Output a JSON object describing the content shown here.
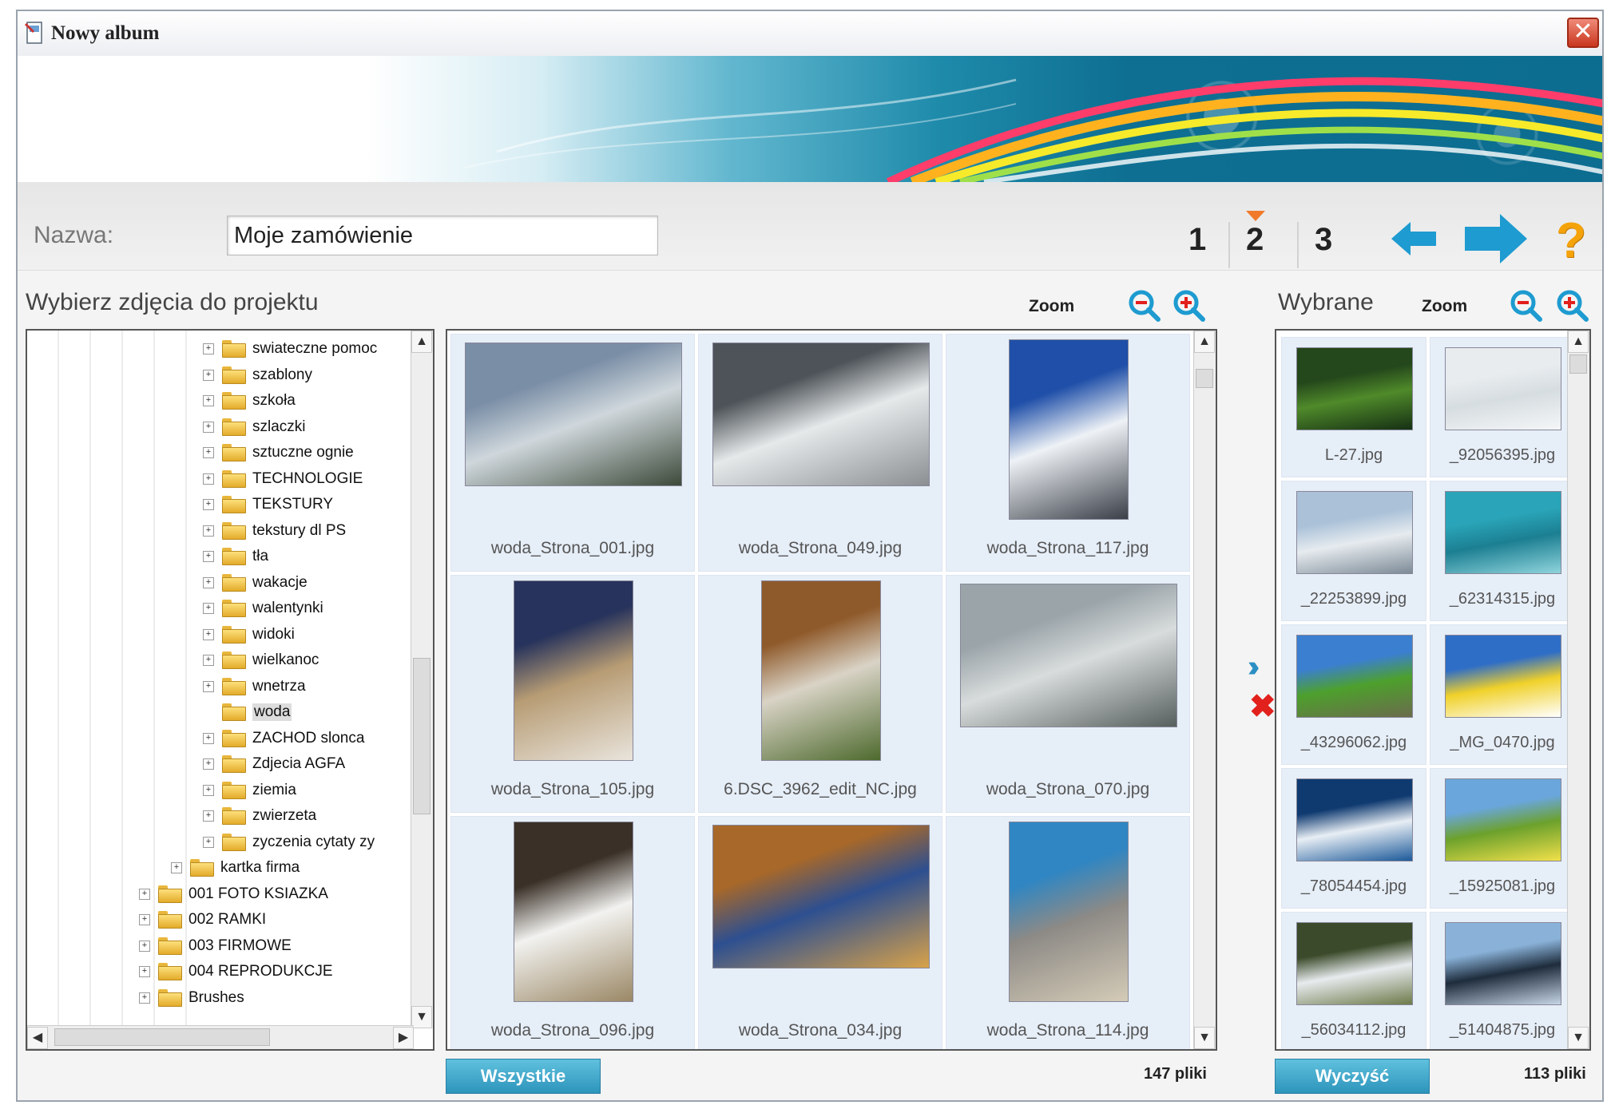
{
  "window": {
    "title": "Nowy album",
    "close_glyph": "✕"
  },
  "toolbar": {
    "name_label": "Nazwa:",
    "name_value": "Moje zamówienie",
    "steps": [
      "1",
      "2",
      "3"
    ],
    "active_step": 2,
    "help_glyph": "?"
  },
  "browser": {
    "title": "Wybierz zdjęcia do projektu",
    "zoom_label": "Zoom",
    "count_label": "147 pliki",
    "all_button": "Wszystkie"
  },
  "selected": {
    "title": "Wybrane",
    "zoom_label": "Zoom",
    "count_label": "113 pliki",
    "clear_button": "Wyczyść"
  },
  "tree": [
    {
      "label": "swiateczne pomoc",
      "level": 2,
      "expandable": true
    },
    {
      "label": "szablony",
      "level": 2,
      "expandable": true
    },
    {
      "label": "szkoła",
      "level": 2,
      "expandable": true
    },
    {
      "label": "szlaczki",
      "level": 2,
      "expandable": true
    },
    {
      "label": "sztuczne ognie",
      "level": 2,
      "expandable": true
    },
    {
      "label": "TECHNOLOGIE",
      "level": 2,
      "expandable": true
    },
    {
      "label": "TEKSTURY",
      "level": 2,
      "expandable": true
    },
    {
      "label": "tekstury dl PS",
      "level": 2,
      "expandable": true
    },
    {
      "label": "tła",
      "level": 2,
      "expandable": true
    },
    {
      "label": "wakacje",
      "level": 2,
      "expandable": true
    },
    {
      "label": "walentynki",
      "level": 2,
      "expandable": true
    },
    {
      "label": "widoki",
      "level": 2,
      "expandable": true
    },
    {
      "label": "wielkanoc",
      "level": 2,
      "expandable": true
    },
    {
      "label": "wnetrza",
      "level": 2,
      "expandable": true
    },
    {
      "label": "woda",
      "level": 2,
      "expandable": false,
      "selected": true
    },
    {
      "label": "ZACHOD slonca",
      "level": 2,
      "expandable": true
    },
    {
      "label": "Zdjecia AGFA",
      "level": 2,
      "expandable": true
    },
    {
      "label": "ziemia",
      "level": 2,
      "expandable": true
    },
    {
      "label": "zwierzeta",
      "level": 2,
      "expandable": true
    },
    {
      "label": "zyczenia cytaty zy",
      "level": 2,
      "expandable": true
    },
    {
      "label": "kartka firma",
      "level": 1,
      "expandable": true
    },
    {
      "label": "001 FOTO KSIAZKA",
      "level": 0,
      "expandable": true
    },
    {
      "label": "002 RAMKI",
      "level": 0,
      "expandable": true
    },
    {
      "label": "003 FIRMOWE",
      "level": 0,
      "expandable": true
    },
    {
      "label": "004 REPRODUKCJE",
      "level": 0,
      "expandable": true
    },
    {
      "label": "Brushes",
      "level": 0,
      "expandable": true
    }
  ],
  "photos": [
    {
      "name": "woda_Strona_001.jpg",
      "orientation": "landscape",
      "colors": [
        "#7a8ea6",
        "#cfd7dc",
        "#3d4a3a"
      ]
    },
    {
      "name": "woda_Strona_049.jpg",
      "orientation": "landscape",
      "colors": [
        "#4d5358",
        "#e6e9ea",
        "#8b8f92"
      ]
    },
    {
      "name": "woda_Strona_117.jpg",
      "orientation": "portrait",
      "colors": [
        "#1f4fa8",
        "#eef2f6",
        "#3a3f48"
      ]
    },
    {
      "name": "woda_Strona_105.jpg",
      "orientation": "portrait",
      "colors": [
        "#27335c",
        "#b79c74",
        "#e9e4dc"
      ]
    },
    {
      "name": "6.DSC_3962_edit_NC.jpg",
      "orientation": "portrait",
      "colors": [
        "#8f5a2b",
        "#d9d3c6",
        "#4e6a2e"
      ]
    },
    {
      "name": "woda_Strona_070.jpg",
      "orientation": "landscape",
      "colors": [
        "#9aa4a9",
        "#d8dcdc",
        "#56605e"
      ]
    },
    {
      "name": "woda_Strona_096.jpg",
      "orientation": "portrait",
      "colors": [
        "#3a3027",
        "#f2f2f0",
        "#9b8866"
      ]
    },
    {
      "name": "woda_Strona_034.jpg",
      "orientation": "landscape",
      "colors": [
        "#a7682a",
        "#2d4f90",
        "#d8a24a"
      ]
    },
    {
      "name": "woda_Strona_114.jpg",
      "orientation": "portrait",
      "colors": [
        "#2f86c3",
        "#8d8a86",
        "#d4cbb7"
      ]
    }
  ],
  "selected_photos": [
    {
      "name": "L-27.jpg",
      "colors": [
        "#24471b",
        "#4f8a2a",
        "#163014"
      ]
    },
    {
      "name": "_92056395.jpg",
      "colors": [
        "#e8ecef",
        "#d6dde0",
        "#f4f6f7"
      ]
    },
    {
      "name": "_22253899.jpg",
      "colors": [
        "#aac1d8",
        "#e6ebef",
        "#7d8b97"
      ]
    },
    {
      "name": "_62314315.jpg",
      "colors": [
        "#2aa4b8",
        "#1c7f92",
        "#8fd4dc"
      ]
    },
    {
      "name": "_43296062.jpg",
      "colors": [
        "#3b7fd0",
        "#4da02c",
        "#6b6b4d"
      ]
    },
    {
      "name": "_MG_0470.jpg",
      "colors": [
        "#2f6ec6",
        "#f0d12a",
        "#ffffff"
      ]
    },
    {
      "name": "_78054454.jpg",
      "colors": [
        "#0f3a70",
        "#e8eef4",
        "#1d5a9a"
      ]
    },
    {
      "name": "_15925081.jpg",
      "colors": [
        "#6aa6db",
        "#6ca12c",
        "#f1e04a"
      ]
    },
    {
      "name": "_56034112.jpg",
      "colors": [
        "#3b4a2a",
        "#e7ebee",
        "#6d7a4a"
      ]
    },
    {
      "name": "_51404875.jpg",
      "colors": [
        "#8ab2d8",
        "#1e2c3c",
        "#c7d6e6"
      ]
    }
  ]
}
